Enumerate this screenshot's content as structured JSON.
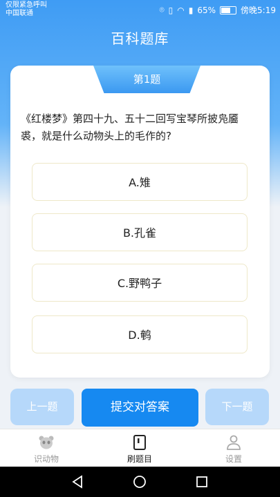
{
  "status_bar": {
    "carrier_line1": "仅限紧急呼叫",
    "carrier_line2": "中国联通",
    "battery": "65%",
    "time": "傍晚5:19"
  },
  "header": {
    "title": "百科题库"
  },
  "question": {
    "number_label": "第1题",
    "text": "《红楼梦》第四十九、五十二回写宝琴所披凫靥裘，就是什么动物头上的毛作的?",
    "options": [
      "A.雉",
      "B.孔雀",
      "C.野鸭子",
      "D.鹌"
    ]
  },
  "actions": {
    "prev_label": "上一题",
    "submit_label": "提交对答案",
    "next_label": "下一题"
  },
  "bottom_nav": {
    "items": [
      {
        "label": "识动物",
        "icon": "panda-icon"
      },
      {
        "label": "刷题目",
        "icon": "book-icon",
        "active": true
      },
      {
        "label": "设置",
        "icon": "person-icon"
      }
    ]
  },
  "system_nav": {
    "icons": [
      "back-icon",
      "home-icon",
      "recents-icon"
    ]
  }
}
